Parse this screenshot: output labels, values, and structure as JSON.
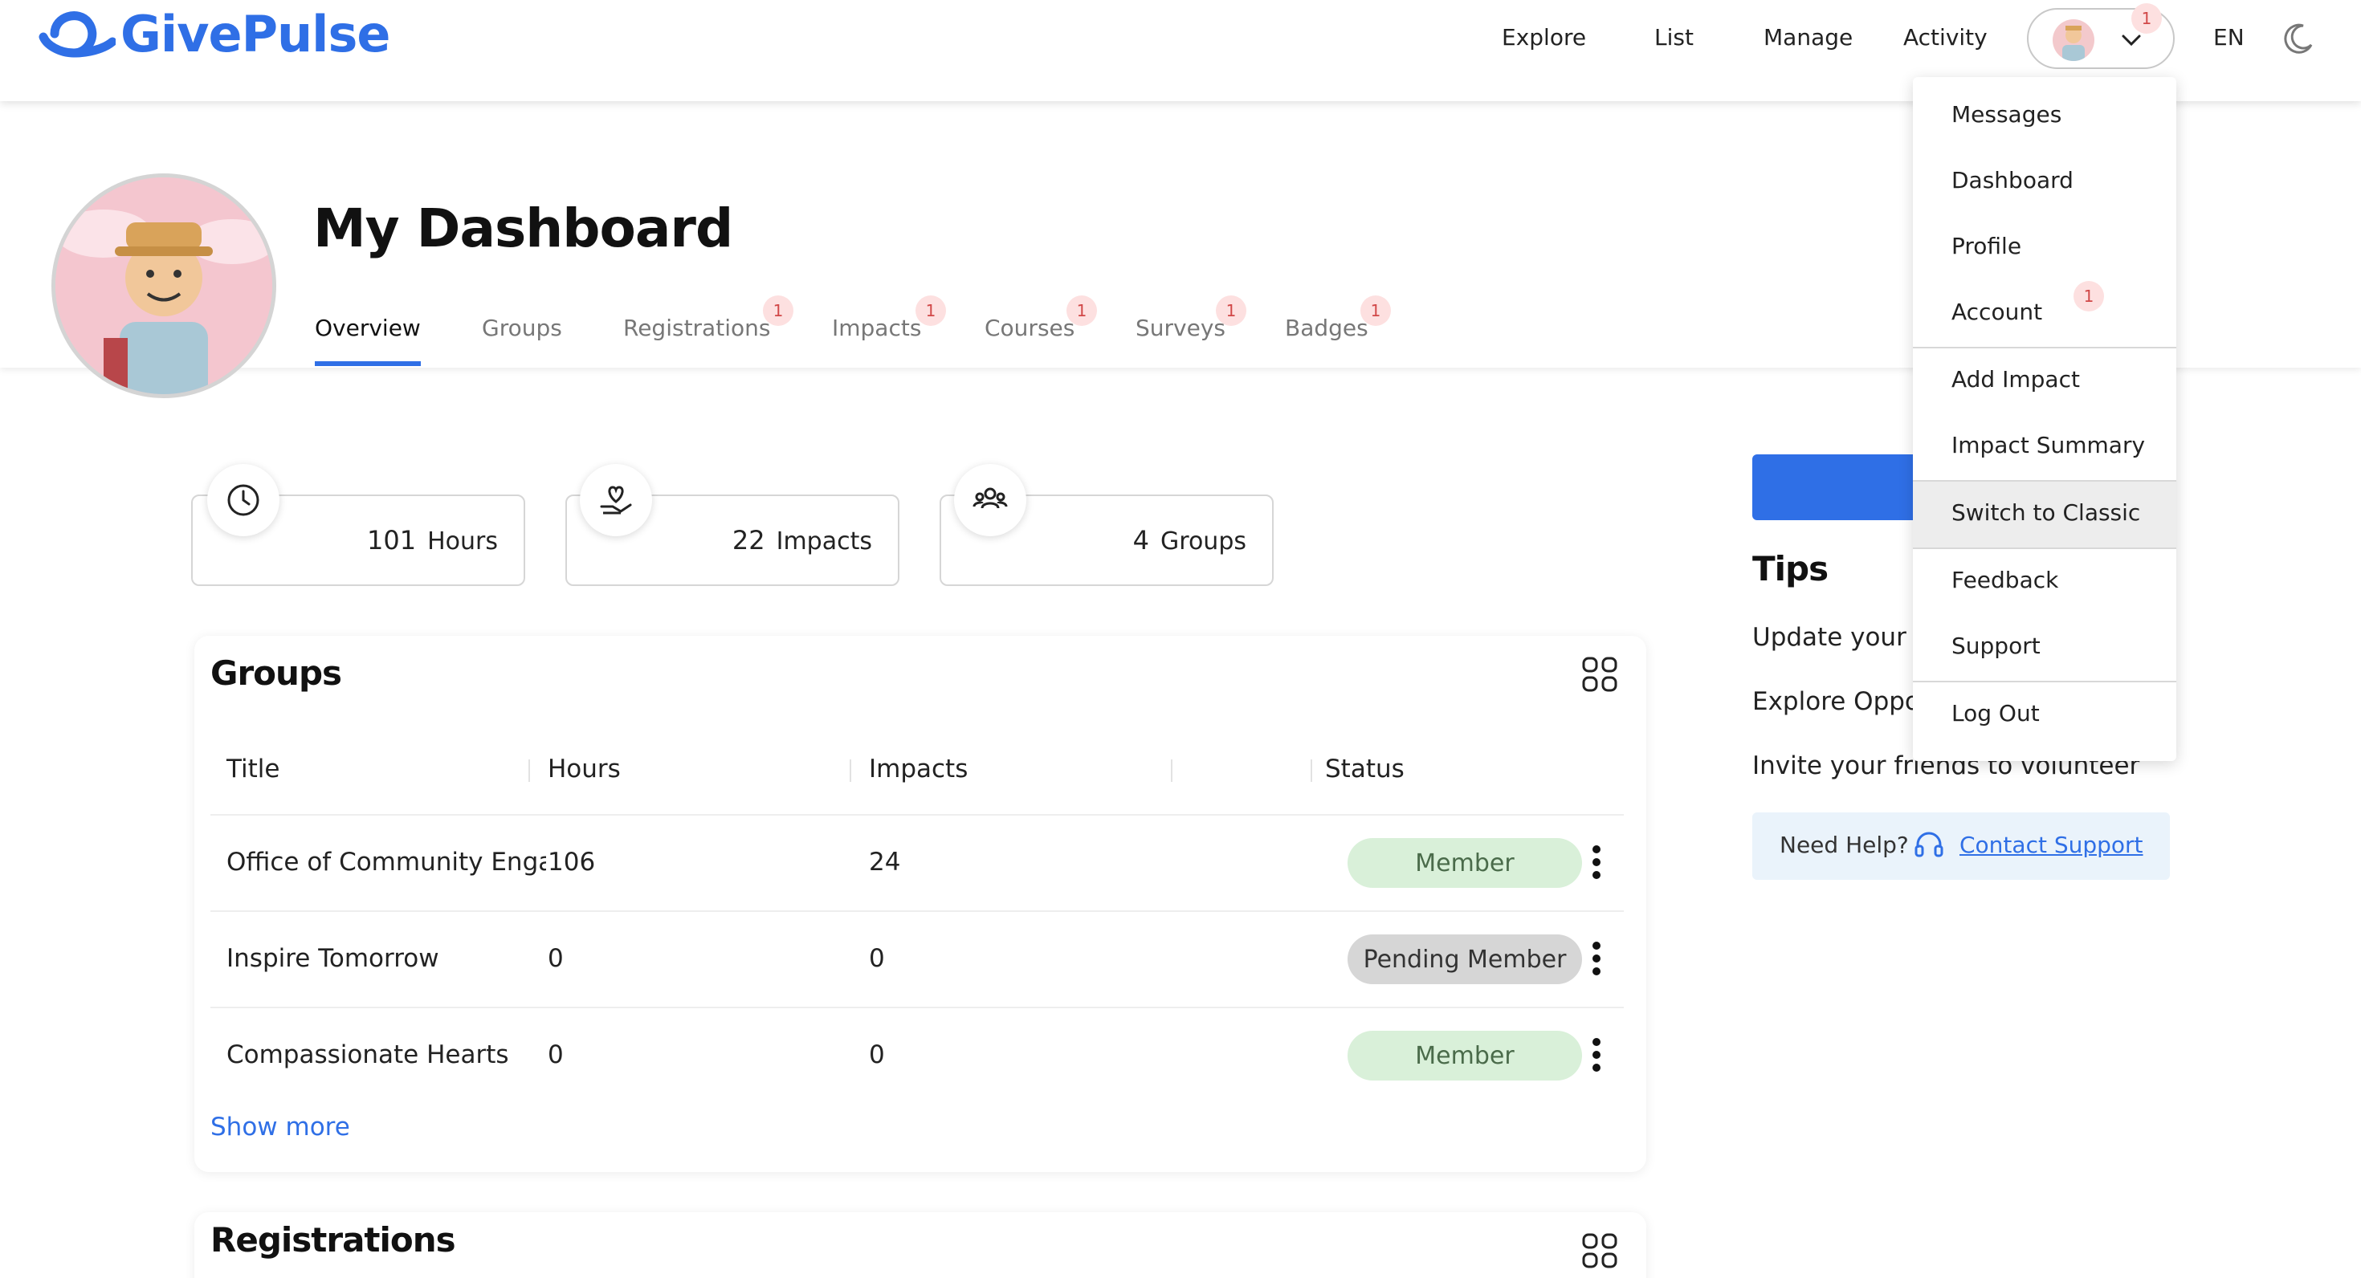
{
  "header": {
    "logo_text": "GivePulse",
    "nav": [
      "Explore",
      "List",
      "Manage",
      "Activity"
    ],
    "user_notification_count": "1",
    "language": "EN"
  },
  "page": {
    "title": "My Dashboard",
    "tabs": [
      {
        "label": "Overview",
        "badge": ""
      },
      {
        "label": "Groups",
        "badge": ""
      },
      {
        "label": "Registrations",
        "badge": "1"
      },
      {
        "label": "Impacts",
        "badge": "1"
      },
      {
        "label": "Courses",
        "badge": "1"
      },
      {
        "label": "Surveys",
        "badge": "1"
      },
      {
        "label": "Badges",
        "badge": "1"
      }
    ]
  },
  "stats": [
    {
      "icon": "clock-icon",
      "value": "101",
      "unit": "Hours"
    },
    {
      "icon": "heart-hand-icon",
      "value": "22",
      "unit": "Impacts"
    },
    {
      "icon": "people-icon",
      "value": "4",
      "unit": "Groups"
    }
  ],
  "groups_panel": {
    "title": "Groups",
    "columns": [
      "Title",
      "Hours",
      "Impacts",
      "Status"
    ],
    "rows": [
      {
        "title": "Office of Community Engagement",
        "hours": "106",
        "impacts": "24",
        "status": "Member"
      },
      {
        "title": "Inspire Tomorrow",
        "hours": "0",
        "impacts": "0",
        "status": "Pending Member"
      },
      {
        "title": "Compassionate Hearts",
        "hours": "0",
        "impacts": "0",
        "status": "Member"
      }
    ],
    "show_more": "Show more"
  },
  "registrations_panel": {
    "title": "Registrations"
  },
  "sidebar": {
    "tips_title": "Tips",
    "tips": [
      "Update your",
      "Explore Opport",
      "Invite your friends to volunteer"
    ],
    "help_label": "Need Help?",
    "help_link": "Contact Support"
  },
  "dropdown": {
    "items": [
      "Messages",
      "Dashboard",
      "Profile",
      "Account",
      "Add Impact",
      "Impact Summary",
      "Switch to Classic",
      "Feedback",
      "Support",
      "Log Out"
    ],
    "account_badge": "1"
  },
  "colors": {
    "accent": "#2f6fe6",
    "member_bg": "#d9f0d9",
    "pending_bg": "#d6d6d6",
    "badge_bg": "#fde0e0"
  }
}
